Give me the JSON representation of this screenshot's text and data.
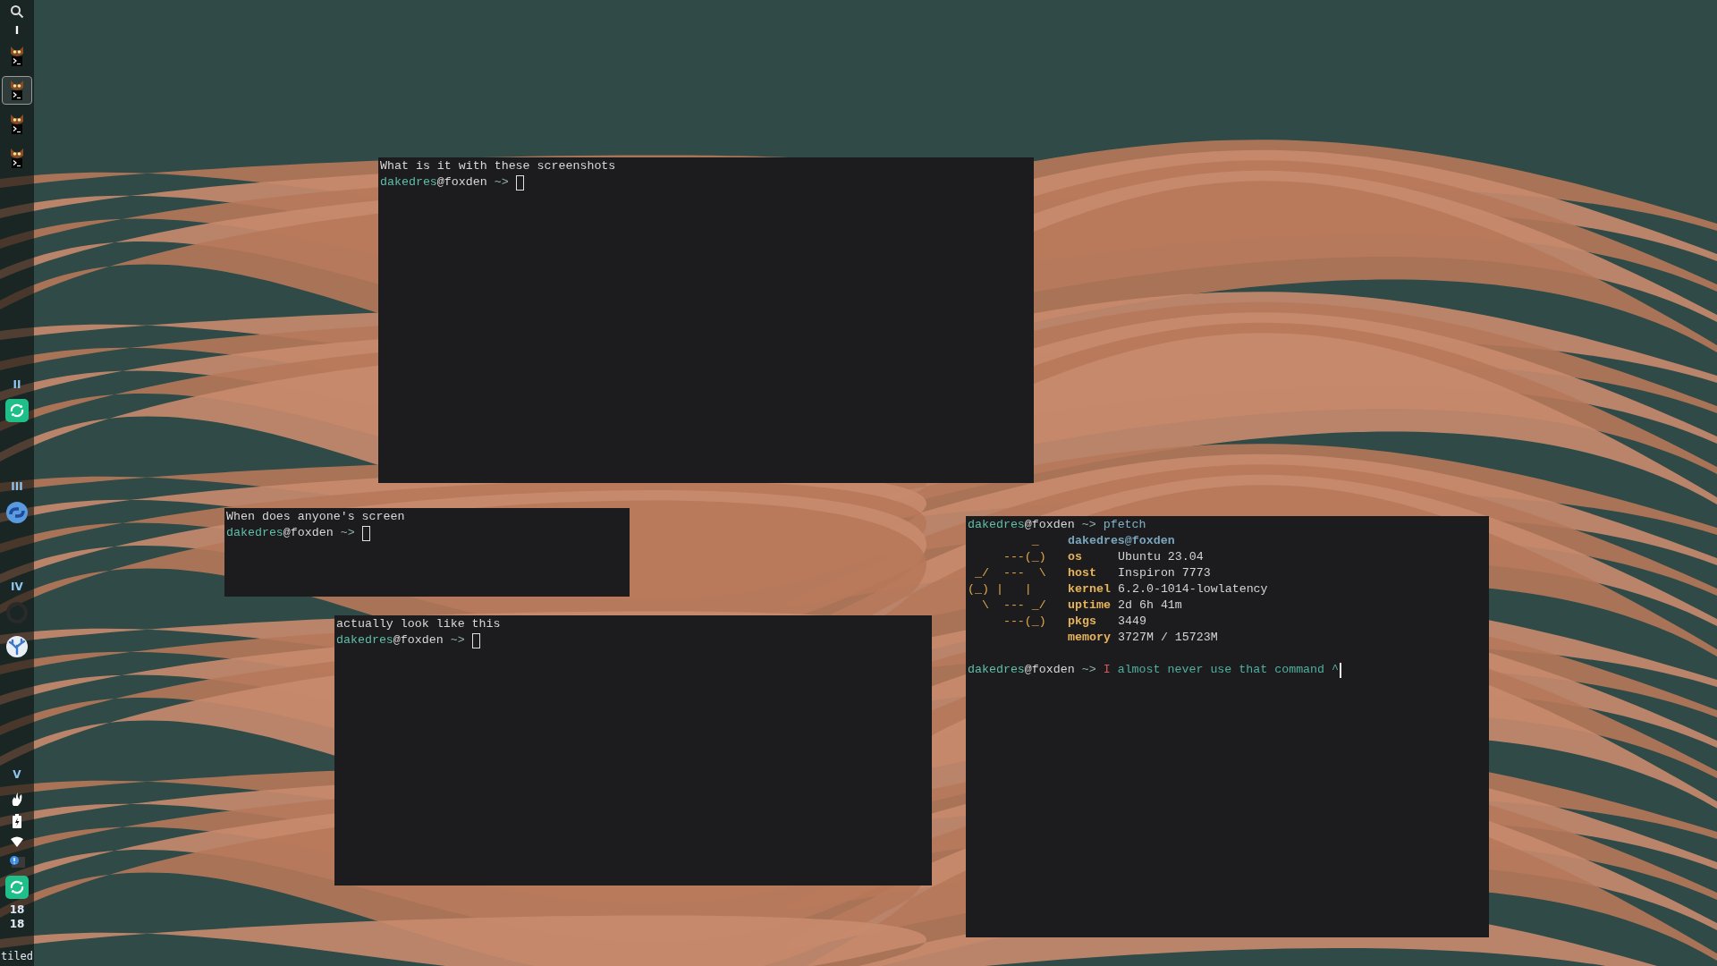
{
  "sidebar": {
    "workspaces": [
      {
        "label": "I",
        "active": true,
        "apps": [
          {
            "kind": "terminal",
            "selected": false
          },
          {
            "kind": "terminal",
            "selected": true
          },
          {
            "kind": "terminal",
            "selected": false
          },
          {
            "kind": "terminal",
            "selected": false
          }
        ]
      },
      {
        "label": "II",
        "active": false,
        "apps": [
          {
            "kind": "sync",
            "selected": false
          }
        ]
      },
      {
        "label": "III",
        "active": false,
        "apps": [
          {
            "kind": "link",
            "selected": false
          }
        ]
      },
      {
        "label": "IV",
        "active": false,
        "apps": [
          {
            "kind": "ring",
            "selected": false
          },
          {
            "kind": "coral",
            "selected": false
          }
        ]
      },
      {
        "label": "V",
        "active": false
      }
    ],
    "tray": [
      {
        "kind": "flame"
      },
      {
        "kind": "battery"
      },
      {
        "kind": "wifi"
      },
      {
        "kind": "alert"
      },
      {
        "kind": "sync"
      }
    ],
    "clock": [
      "18",
      "18"
    ],
    "layout": "tiled"
  },
  "terminals": [
    {
      "lines": [
        {
          "kind": "output",
          "text": "What is it with these screenshots"
        },
        {
          "kind": "prompt",
          "user": "dakedres",
          "host": "@foxden",
          "arrow": "~>",
          "cursor": {
            "kind": "block"
          }
        }
      ]
    },
    {
      "lines": [
        {
          "kind": "output",
          "text": "When does anyone's screen"
        },
        {
          "kind": "prompt",
          "user": "dakedres",
          "host": "@foxden",
          "arrow": "~>",
          "cursor": {
            "kind": "block"
          }
        }
      ]
    },
    {
      "lines": [
        {
          "kind": "output",
          "text": "actually look like this"
        },
        {
          "kind": "prompt",
          "user": "dakedres",
          "host": "@foxden",
          "arrow": "~>",
          "cursor": {
            "kind": "block"
          }
        }
      ]
    },
    {
      "lines": [
        {
          "kind": "prompt",
          "user": "dakedres",
          "host": "@foxden",
          "arrow": "~>",
          "command": "pfetch",
          "valid": true
        },
        {
          "kind": "pfetch",
          "title": "dakedres@foxden",
          "art": [
            "         _",
            "     ---(_)",
            " _/  ---  \\",
            "(_) |   |",
            "  \\  --- _/",
            "     ---(_)"
          ],
          "fields": [
            {
              "key": "os",
              "value": "Ubuntu 23.04"
            },
            {
              "key": "host",
              "value": "Inspiron 7773"
            },
            {
              "key": "kernel",
              "value": "6.2.0-1014-lowlatency"
            },
            {
              "key": "uptime",
              "value": "2d 6h 41m"
            },
            {
              "key": "pkgs",
              "value": "3449"
            },
            {
              "key": "memory",
              "value": "3727M / 15723M"
            }
          ]
        },
        {
          "kind": "blank"
        },
        {
          "kind": "prompt",
          "user": "dakedres",
          "host": "@foxden",
          "arrow": "~>",
          "command": "I",
          "args": "almost never use that command ^",
          "valid": false,
          "cursor": {
            "kind": "bar"
          }
        }
      ]
    }
  ]
}
